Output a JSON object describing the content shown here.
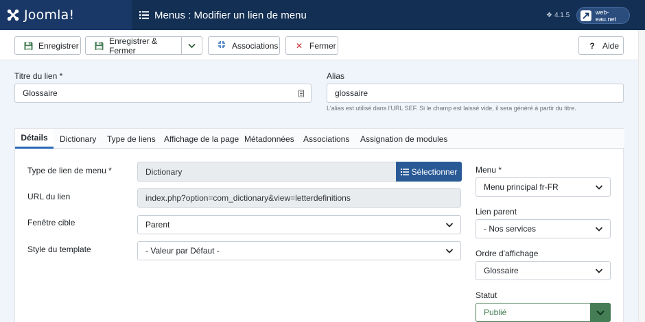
{
  "header": {
    "brand": "Joomla!",
    "title": "Menus : Modifier un lien de menu",
    "version": "4.1.5",
    "site": "web-eau.net"
  },
  "toolbar": {
    "save": "Enregistrer",
    "save_close": "Enregistrer & Fermer",
    "associations": "Associations",
    "close": "Fermer",
    "help": "Aide"
  },
  "form": {
    "title_label": "Titre du lien *",
    "title_value": "Glossaire",
    "alias_label": "Alias",
    "alias_value": "glossaire",
    "alias_hint": "L'alias est utilisé dans l'URL SEF. Si le champ est laissé vide, il sera généré à partir du titre."
  },
  "tabs": [
    "Détails",
    "Dictionary",
    "Type de liens",
    "Affichage de la page",
    "Métadonnées",
    "Associations",
    "Assignation de modules"
  ],
  "details": {
    "menu_type_label": "Type de lien de menu *",
    "menu_type_value": "Dictionary",
    "select_button": "Sélectionner",
    "url_label": "URL du lien",
    "url_value": "index.php?option=com_dictionary&view=letterdefinitions",
    "target_label": "Fenêtre cible",
    "target_value": "Parent",
    "template_label": "Style du template",
    "template_value": "- Valeur par Défaut -"
  },
  "side": {
    "menu_label": "Menu *",
    "menu_value": "Menu principal fr-FR",
    "parent_label": "Lien parent",
    "parent_value": "- Nos services",
    "order_label": "Ordre d'affichage",
    "order_value": "Glossaire",
    "status_label": "Statut",
    "status_value": "Publié"
  },
  "colors": {
    "header_bg": "#132f53",
    "primary": "#2a5a96",
    "success": "#457d54",
    "danger": "#c52827"
  }
}
